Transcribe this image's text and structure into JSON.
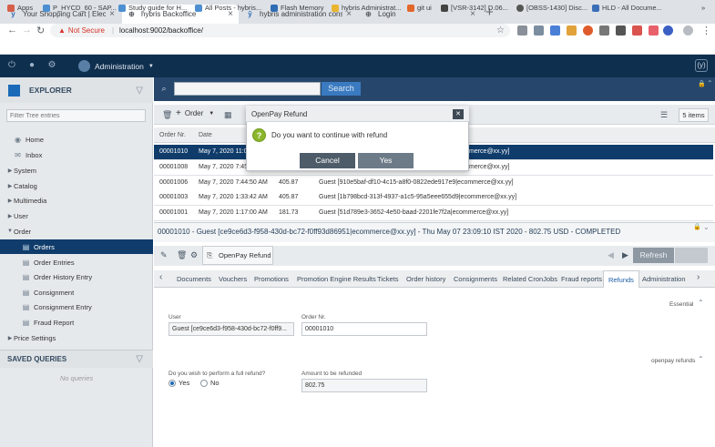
{
  "browser": {
    "tabs": [
      {
        "title": "Your Shopping Cart | Electronic",
        "icon": "hybris-icon"
      },
      {
        "title": "hybris Backoffice",
        "icon": "globe-icon"
      },
      {
        "title": "hybris administration console",
        "icon": "hybris-icon"
      },
      {
        "title": "Login",
        "icon": "globe-icon"
      }
    ],
    "security_label": "Not Secure",
    "url": "localhost:9002/backoffice/",
    "bookmarks": [
      "Apps",
      "P_HYCD_60 - SAP...",
      "Study guide for H...",
      "All Posts - hybris...",
      "Flash Memory",
      "hybris Administrat...",
      "git ui",
      "[VSR-3142] D.06...",
      "[OBSS-1430] Disc...",
      "HLD - All Docume..."
    ],
    "bookmarks_more": "»"
  },
  "app_header": {
    "perspective": "Administration"
  },
  "explorer": {
    "title": "EXPLORER",
    "filter_placeholder": "Filter Tree entries",
    "items": [
      {
        "label": "Home",
        "icon": "home-icon"
      },
      {
        "label": "Inbox",
        "icon": "inbox-icon"
      },
      {
        "label": "System",
        "icon": "folder-icon"
      },
      {
        "label": "Catalog",
        "icon": "folder-icon"
      },
      {
        "label": "Multimedia",
        "icon": "folder-icon"
      },
      {
        "label": "User",
        "icon": "folder-icon"
      },
      {
        "label": "Order",
        "icon": "folder-icon"
      },
      {
        "label": "Orders",
        "icon": "document-icon"
      },
      {
        "label": "Order Entries",
        "icon": "document-icon"
      },
      {
        "label": "Order History Entry",
        "icon": "document-icon"
      },
      {
        "label": "Consignment",
        "icon": "document-icon"
      },
      {
        "label": "Consignment Entry",
        "icon": "document-icon"
      },
      {
        "label": "Fraud Report",
        "icon": "document-icon"
      },
      {
        "label": "Price Settings",
        "icon": "folder-icon"
      }
    ],
    "saved_queries_title": "SAVED QUERIES",
    "no_queries": "No queries"
  },
  "list": {
    "search_button": "Search",
    "order_dropdown": "Order",
    "items_count": "5 items",
    "columns": [
      "Order Nr.",
      "Date"
    ],
    "rows": [
      {
        "order": "00001010",
        "date": "May 7, 2020 11:0",
        "total": "",
        "user": "merce@xx.yy]",
        "selected": true
      },
      {
        "order": "00001008",
        "date": "May 7, 2020 7:45",
        "total": "",
        "user": "merce@xx.yy]",
        "selected": false
      },
      {
        "order": "00001006",
        "date": "May 7, 2020 7:44:50 AM",
        "total": "405.87",
        "user": "Guest [910e5baf-df10-4c15-a8f0-0822ede917e9|ecommerce@xx.yy]",
        "selected": false
      },
      {
        "order": "00001003",
        "date": "May 7, 2020 1:33:42 AM",
        "total": "405.87",
        "user": "Guest [1b798bcd-313f-4937-a1c5-95a5eee655d9|ecommerce@xx.yy]",
        "selected": false
      },
      {
        "order": "00001001",
        "date": "May 7, 2020 1:17:00 AM",
        "total": "181.73",
        "user": "Guest [51d789e3-3652-4e50-baad-2201fe7f2a|ecommerce@xx.yy]",
        "selected": false
      }
    ]
  },
  "detail": {
    "title": "00001010 - Guest [ce9ce6d3-f958-430d-bc72-f0ff93d86951|ecommerce@xx.yy] - Thu May 07 23:09:10 IST 2020 - 802.75 USD - COMPLETED",
    "openpay_refund_button": "OpenPay Refund",
    "refresh_button": "Refresh",
    "tabs": [
      "Documents",
      "Vouchers",
      "Promotions",
      "Promotion Engine Results",
      "Tickets",
      "Order history",
      "Consignments",
      "Related CronJobs",
      "Fraud reports",
      "Refunds",
      "Administration"
    ],
    "active_tab": "Refunds",
    "essential_label": "Essential",
    "user_label": "User",
    "user_value": "Guest [ce9ce6d3-f958-430d-bc72-f0ff9...",
    "order_nr_label": "Order Nr.",
    "order_nr_value": "00001010",
    "openpay_refunds_label": "openpay refunds",
    "full_refund_question": "Do you wish to perform a full refund?",
    "yes_label": "Yes",
    "no_label": "No",
    "full_refund_selected": "Yes",
    "amount_label": "Amount to be refunded",
    "amount_value": "802.75"
  },
  "modal": {
    "title": "OpenPay Refund",
    "message": "Do you want to continue with refund",
    "cancel": "Cancel",
    "yes": "Yes"
  }
}
